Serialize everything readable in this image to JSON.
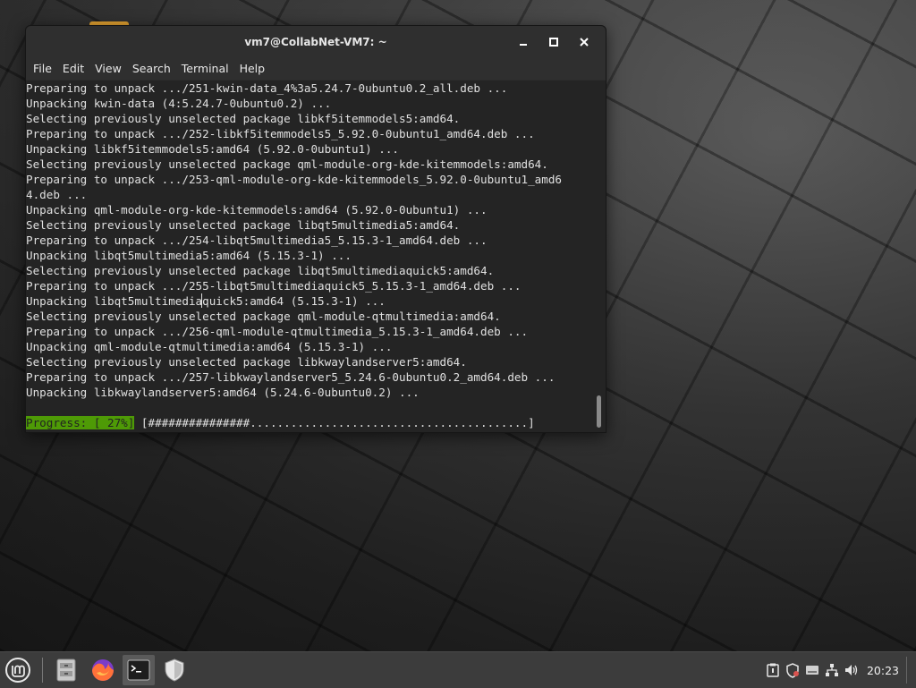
{
  "window": {
    "title": "vm7@CollabNet-VM7: ~",
    "controls": [
      "minimize",
      "maximize",
      "close"
    ]
  },
  "menu": [
    "File",
    "Edit",
    "View",
    "Search",
    "Terminal",
    "Help"
  ],
  "terminal": {
    "lines": [
      "Preparing to unpack .../251-kwin-data_4%3a5.24.7-0ubuntu0.2_all.deb ...",
      "Unpacking kwin-data (4:5.24.7-0ubuntu0.2) ...",
      "Selecting previously unselected package libkf5itemmodels5:amd64.",
      "Preparing to unpack .../252-libkf5itemmodels5_5.92.0-0ubuntu1_amd64.deb ...",
      "Unpacking libkf5itemmodels5:amd64 (5.92.0-0ubuntu1) ...",
      "Selecting previously unselected package qml-module-org-kde-kitemmodels:amd64.",
      "Preparing to unpack .../253-qml-module-org-kde-kitemmodels_5.92.0-0ubuntu1_amd6",
      "4.deb ...",
      "Unpacking qml-module-org-kde-kitemmodels:amd64 (5.92.0-0ubuntu1) ...",
      "Selecting previously unselected package libqt5multimedia5:amd64.",
      "Preparing to unpack .../254-libqt5multimedia5_5.15.3-1_amd64.deb ...",
      "Unpacking libqt5multimedia5:amd64 (5.15.3-1) ...",
      "Selecting previously unselected package libqt5multimediaquick5:amd64.",
      "Preparing to unpack .../255-libqt5multimediaquick5_5.15.3-1_amd64.deb ...",
      "Unpacking libqt5multimediaquick5:amd64 (5.15.3-1) ...",
      "Selecting previously unselected package qml-module-qtmultimedia:amd64.",
      "Preparing to unpack .../256-qml-module-qtmultimedia_5.15.3-1_amd64.deb ...",
      "Unpacking qml-module-qtmultimedia:amd64 (5.15.3-1) ...",
      "Selecting previously unselected package libkwaylandserver5:amd64.",
      "Preparing to unpack .../257-libkwaylandserver5_5.24.6-0ubuntu0.2_amd64.deb ...",
      "Unpacking libkwaylandserver5:amd64 (5.24.6-0ubuntu0.2) ...",
      ""
    ],
    "progress_label": "Progress: [ 27%]",
    "progress_bar": " [###############.........................................]",
    "progress_percent": 27
  },
  "taskbar": {
    "launchers": [
      "mint-menu-icon",
      "file-manager-icon",
      "firefox-icon",
      "terminal-icon",
      "shield-icon"
    ],
    "tray": [
      "clipboard-icon",
      "shield-update-icon",
      "drive-icon",
      "network-icon",
      "volume-icon"
    ],
    "clock": "20:23"
  },
  "colors": {
    "progress_green": "#4e9a06",
    "terminal_bg": "#242424",
    "titlebar_bg": "#2f2f2f",
    "taskbar_bg": "#3c3c3c",
    "mint_green": "#86be43"
  }
}
